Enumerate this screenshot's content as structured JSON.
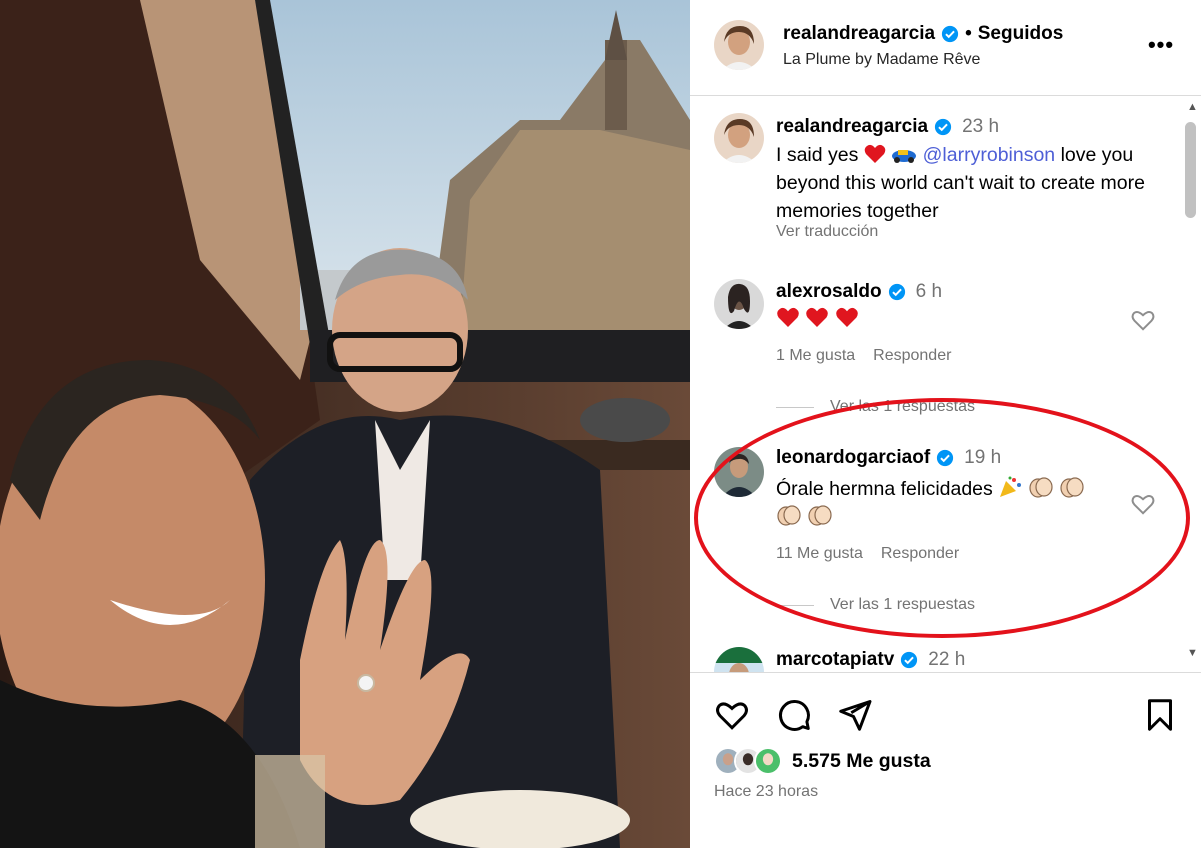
{
  "post_photo": {
    "alt_icon": "photo"
  },
  "header": {
    "username": "realandreagarcia",
    "separator": "•",
    "follow_status": "Seguidos",
    "location": "La Plume by Madame Rêve",
    "more_icon": "more-horizontal-icon",
    "more_label": "•••"
  },
  "comments": [
    {
      "username": "realandreagarcia",
      "time": "23 h",
      "text_before": "I said yes",
      "mention": "@larryrobinson",
      "text_after": "love you beyond this world can't wait to create more memories together",
      "translate": "Ver traducción"
    },
    {
      "username": "alexrosaldo",
      "time": "6 h",
      "likes": "1 Me gusta",
      "reply": "Responder",
      "replies": "Ver las 1 respuestas"
    },
    {
      "username": "leonardogarciaof",
      "time": "19 h",
      "text_line1": "Órale hermna felicidades",
      "likes": "11 Me gusta",
      "reply": "Responder",
      "replies": "Ver las 1 respuestas"
    },
    {
      "username": "marcotapiatv",
      "time": "22 h"
    }
  ],
  "footer": {
    "like_count": "5.575 Me gusta",
    "time_ago": "Hace 23 horas"
  },
  "colors": {
    "mention": "#4e5fd6",
    "verified": "#0095f6",
    "highlight": "#e3121b",
    "secondary_text": "#737373"
  }
}
